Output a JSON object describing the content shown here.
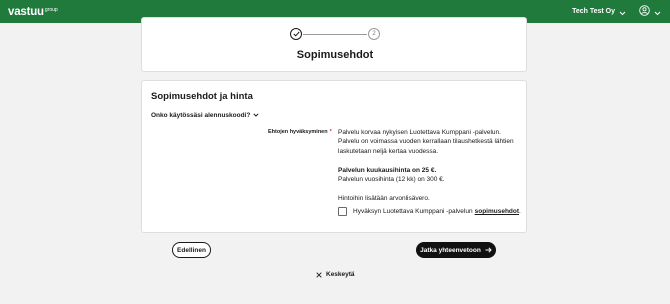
{
  "header": {
    "logo": "vastuu",
    "logo_sup": "group",
    "company": "Tech Test Oy",
    "bg_color": "#1f7a3c"
  },
  "steps": {
    "step2_number": "2",
    "title": "Sopimusehdot"
  },
  "form": {
    "section_title": "Sopimusehdot ja hinta",
    "discount_toggle": "Onko käytössäsi alennuskoodi?",
    "terms_label": "Ehtojen hyväksyminen",
    "required_mark": "*",
    "text_line1": "Palvelu korvaa nykyisen Luotettava Kumppani -palvelun.",
    "text_line2": "Palvelu on voimassa vuoden kerrallaan tilaushetkestä lähtien",
    "text_line3": "laskutetaan neljä kertaa vuodessa.",
    "monthly_price": "Palvelun kuukausihinta on 25 €.",
    "yearly_price": "Palvelun vuosihinta (12 kk) on 300 €.",
    "vat_note": "Hintoihin lisätään arvonlisävero.",
    "accept_text": "Hyväksyn Luotettava Kumppani -palvelun",
    "accept_link": "sopimusehdot",
    "accept_period": "."
  },
  "actions": {
    "back": "Edellinen",
    "next": "Jatka yhteenvetoon",
    "cancel": "Keskeytä"
  }
}
